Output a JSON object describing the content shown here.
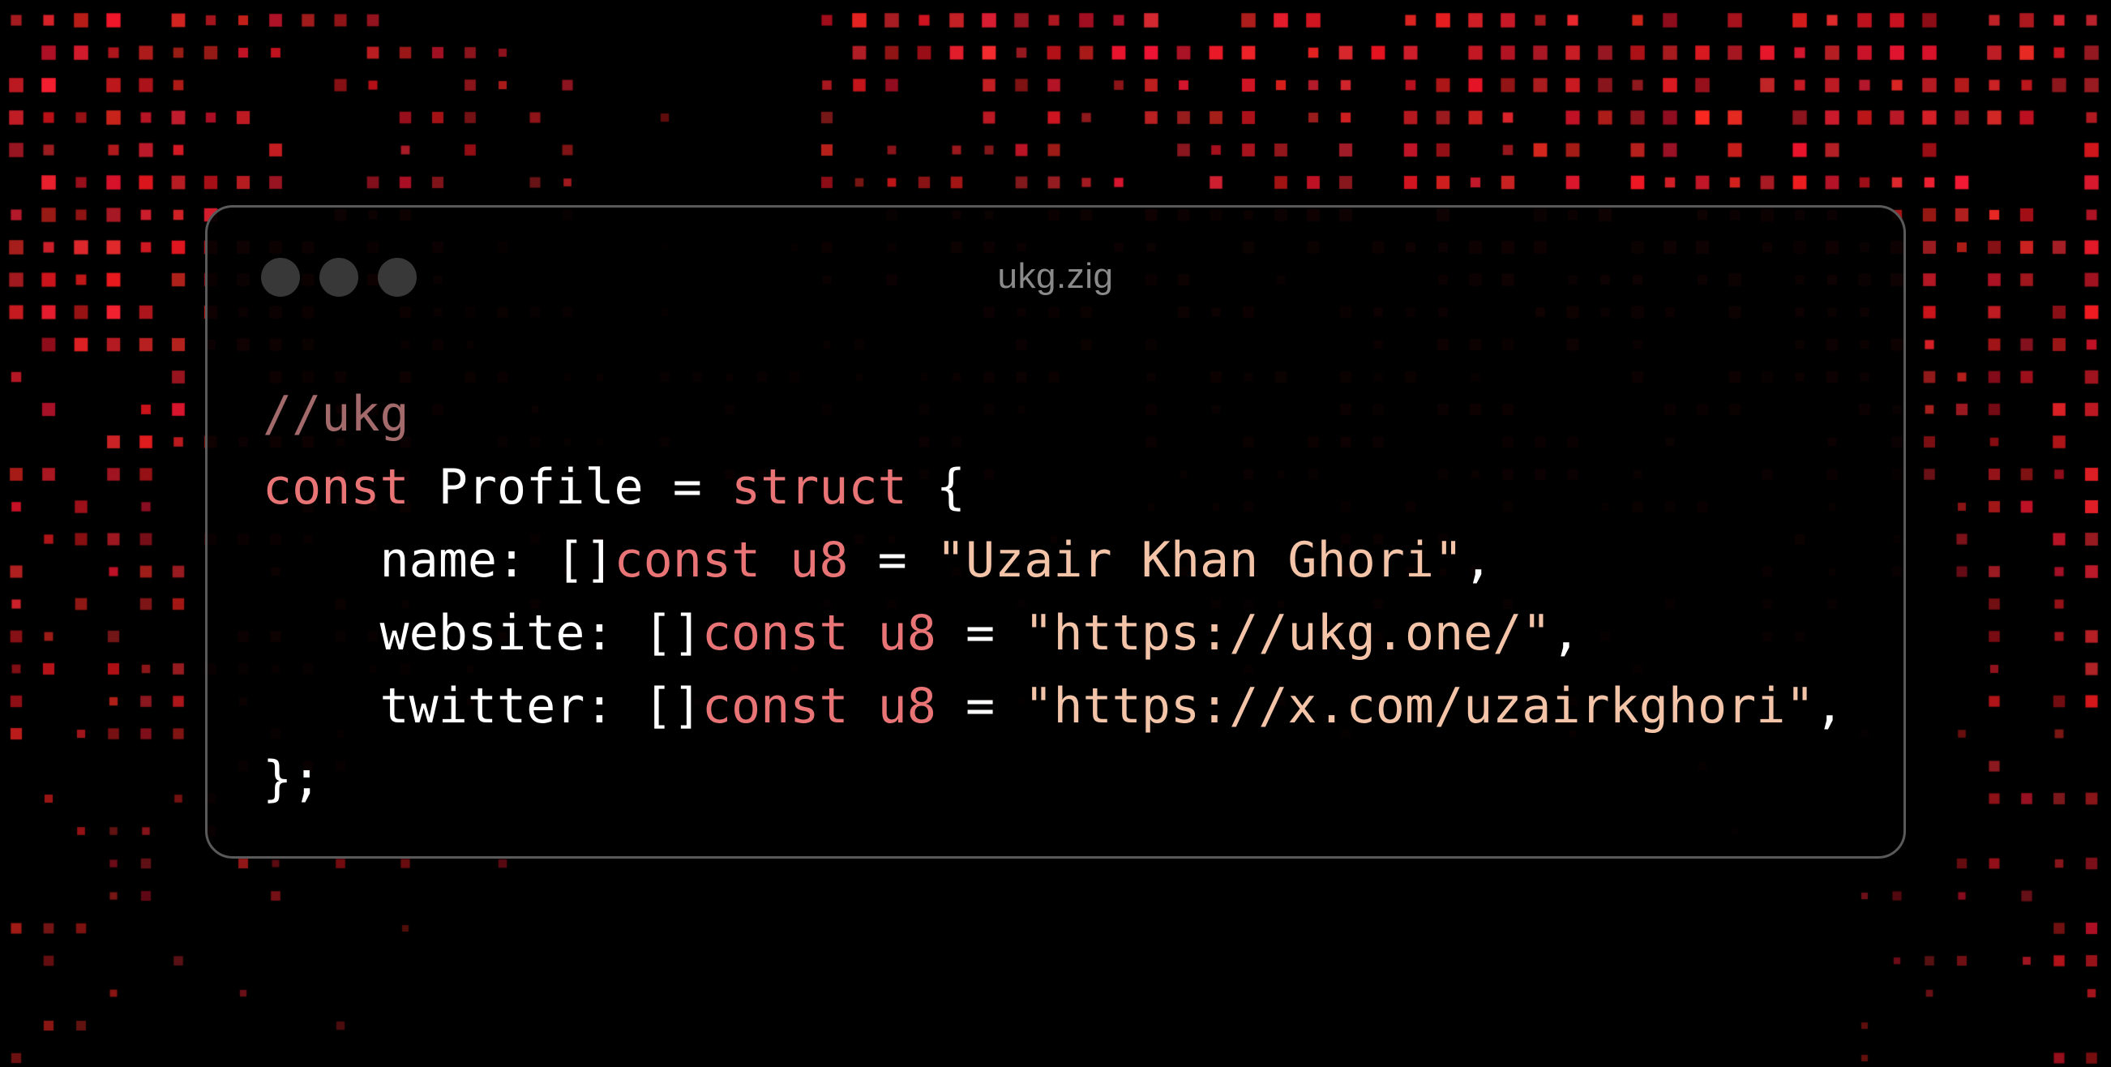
{
  "window": {
    "title": "ukg.zig"
  },
  "colors": {
    "background": "#000000",
    "pixel_red": "#ff2030",
    "window_border": "#5a5a5a",
    "traffic_light": "#383838",
    "comment": "#a36a6c",
    "keyword": "#e87476",
    "string": "#f3c4a8",
    "text": "#ffffff",
    "title": "#8a8a8a"
  },
  "code": {
    "comment": "//ukg",
    "line2": {
      "kw1": "const",
      "name": " Profile = ",
      "kw2": "struct",
      "brace": " {"
    },
    "line3": {
      "indent": "    ",
      "field": "name: []",
      "kw": "const u8",
      "eq": " = ",
      "str": "\"Uzair Khan Ghori\"",
      "end": ","
    },
    "line4": {
      "indent": "    ",
      "field": "website: []",
      "kw": "const u8",
      "eq": " = ",
      "str": "\"https://ukg.one/\"",
      "end": ","
    },
    "line5": {
      "indent": "    ",
      "field": "twitter: []",
      "kw": "const u8",
      "eq": " = ",
      "str": "\"https://x.com/uzairkghori\"",
      "end": ","
    },
    "closing": "};"
  }
}
